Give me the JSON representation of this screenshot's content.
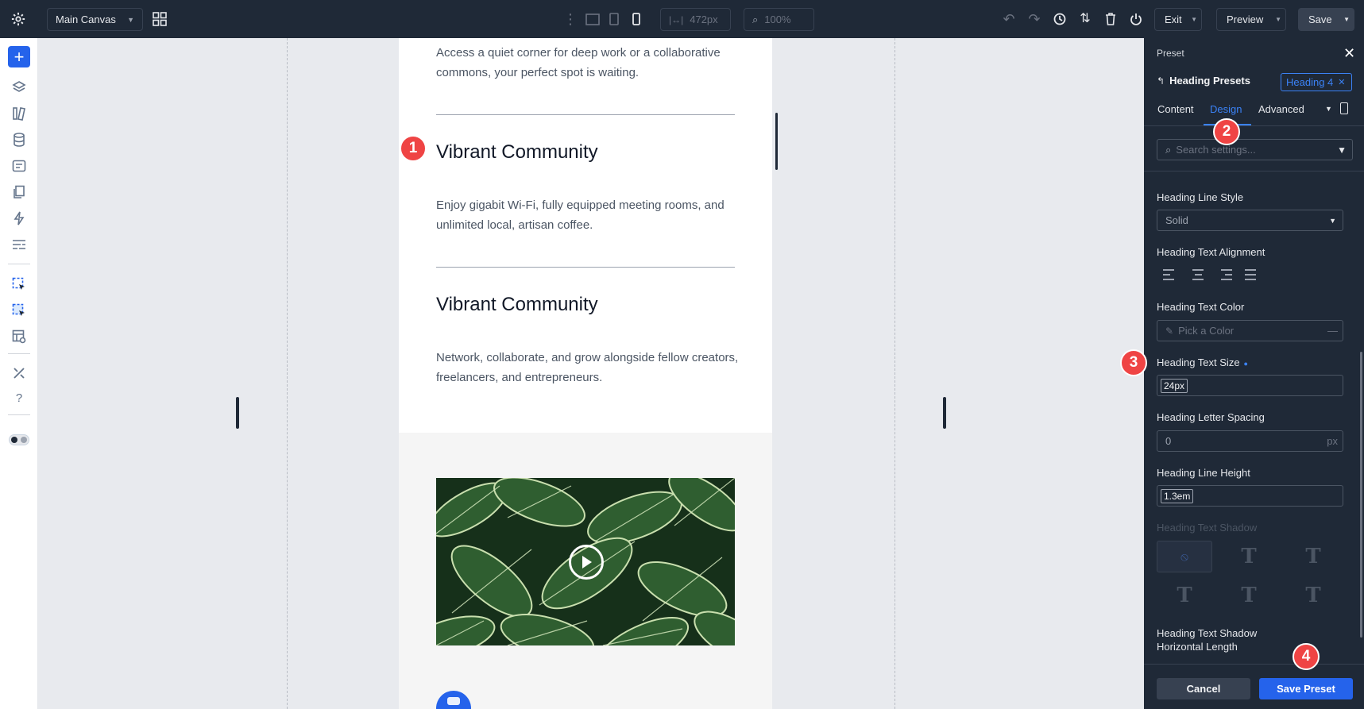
{
  "topbar": {
    "canvas_selector": "Main Canvas",
    "width_value": "472px",
    "zoom_value": "100%",
    "exit_label": "Exit",
    "preview_label": "Preview",
    "save_label": "Save"
  },
  "canvas": {
    "para1": "Access a quiet corner for deep work or a collaborative commons, your perfect spot is waiting.",
    "heading1": "Vibrant Community",
    "para2": "Enjoy gigabit Wi-Fi, fully equipped meeting rooms, and unlimited local, artisan coffee.",
    "heading2": "Vibrant Community",
    "para3": "Network, collaborate, and grow alongside fellow creators, freelancers, and entrepreneurs."
  },
  "badges": {
    "b1": "1",
    "b2": "2",
    "b3": "3",
    "b4": "4"
  },
  "panel": {
    "title": "Preset",
    "back_label": "Heading Presets",
    "preset_chip": "Heading 4",
    "tabs": {
      "content": "Content",
      "design": "Design",
      "advanced": "Advanced"
    },
    "search_placeholder": "Search settings...",
    "line_style_label": "Heading Line Style",
    "line_style_value": "Solid",
    "text_alignment_label": "Heading Text Alignment",
    "text_color_label": "Heading Text Color",
    "text_color_placeholder": "Pick a Color",
    "text_color_dash": "—",
    "text_size_label": "Heading Text Size",
    "text_size_value": "24px",
    "letter_spacing_label": "Heading Letter Spacing",
    "letter_spacing_value": "0",
    "letter_spacing_unit": "px",
    "line_height_label": "Heading Line Height",
    "line_height_value": "1.3em",
    "text_shadow_label": "Heading Text Shadow",
    "shadow_h_label_1": "Heading Text Shadow",
    "shadow_h_label_2": "Horizontal Length",
    "cancel_label": "Cancel",
    "save_preset_label": "Save Preset"
  },
  "colors": {
    "topbar_bg": "#1f2937",
    "accent_blue": "#2563eb",
    "badge_red": "#ef4444"
  },
  "icons": [
    "gear-icon",
    "grid-icon",
    "desktop-icon",
    "tablet-icon",
    "phone-icon",
    "undo-icon",
    "redo-icon",
    "history-icon",
    "sort-icon",
    "trash-icon",
    "power-icon",
    "plus-icon",
    "layers-icon",
    "play-icon",
    "close-icon",
    "filter-icon",
    "eyedropper-icon"
  ]
}
